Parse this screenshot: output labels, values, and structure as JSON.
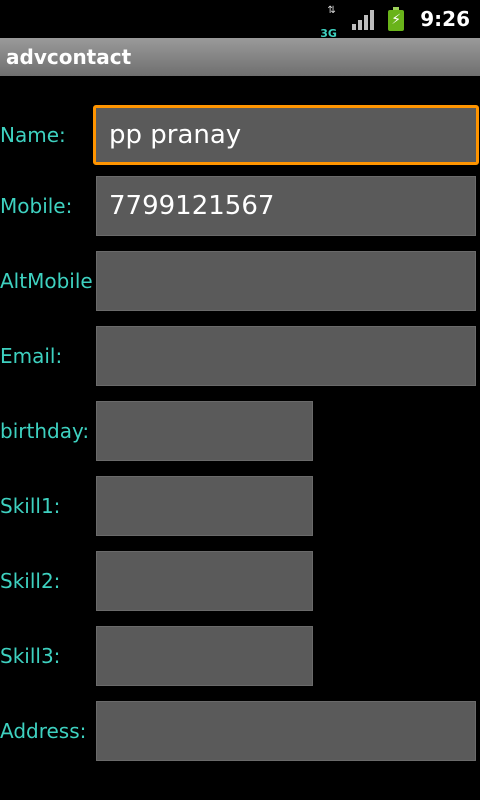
{
  "status_bar": {
    "network_label": "3G",
    "clock": "9:26",
    "icons": [
      "data-arrows-icon",
      "signal-icon",
      "battery-charging-icon"
    ]
  },
  "app": {
    "title": "advcontact"
  },
  "form": {
    "name_label": "Name:",
    "name_value": "pp pranay",
    "mobile_label": "Mobile:",
    "mobile_value": "7799121567",
    "altmobile_label": "AltMobile",
    "altmobile_value": "",
    "email_label": "Email:",
    "email_value": "",
    "birthday_label": "birthday:",
    "birthday_value": "",
    "skill1_label": "Skill1:",
    "skill1_value": "",
    "skill2_label": "Skill2:",
    "skill2_value": "",
    "skill3_label": "Skill3:",
    "skill3_value": "",
    "address_label": "Address:",
    "address_value": ""
  },
  "colors": {
    "label": "#3ed1c0",
    "field_bg": "#5a5a5a",
    "focus": "#ff9400",
    "battery": "#69b31a"
  }
}
